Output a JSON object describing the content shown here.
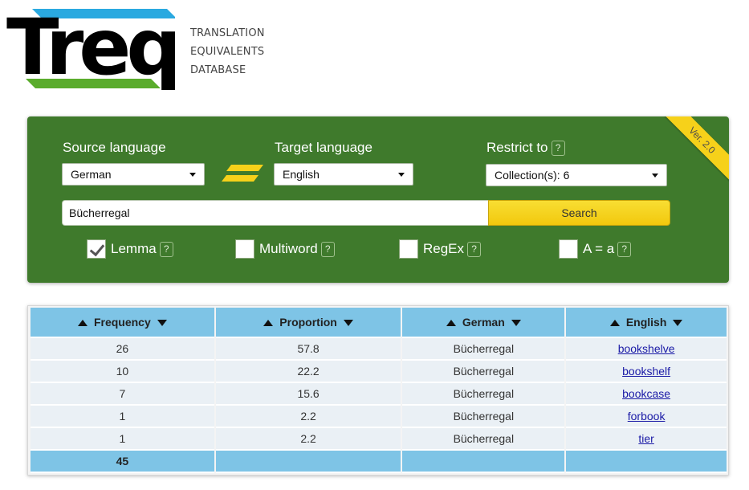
{
  "header": {
    "logo_word": "Treq",
    "subtitle_lines": [
      "TRANSLATION",
      "EQUIVALENTS",
      "DATABASE"
    ]
  },
  "panel": {
    "version_ribbon": "Ver. 2.0",
    "source_label": "Source language",
    "source_value": "German",
    "target_label": "Target language",
    "target_value": "English",
    "restrict_label": "Restrict to",
    "restrict_value": "Collection(s): 6",
    "help_glyph": "?",
    "search_value": "Bücherregal",
    "search_button": "Search",
    "options": [
      {
        "label": "Lemma",
        "checked": true
      },
      {
        "label": "Multiword",
        "checked": false
      },
      {
        "label": "RegEx",
        "checked": false
      },
      {
        "label": "A = a",
        "checked": false
      }
    ]
  },
  "table": {
    "headers": [
      "Frequency",
      "Proportion",
      "German",
      "English"
    ],
    "rows": [
      {
        "frequency": "26",
        "proportion": "57.8",
        "german": "Bücherregal",
        "english": "bookshelve"
      },
      {
        "frequency": "10",
        "proportion": "22.2",
        "german": "Bücherregal",
        "english": "bookshelf"
      },
      {
        "frequency": "7",
        "proportion": "15.6",
        "german": "Bücherregal",
        "english": "bookcase"
      },
      {
        "frequency": "1",
        "proportion": "2.2",
        "german": "Bücherregal",
        "english": "forbook"
      },
      {
        "frequency": "1",
        "proportion": "2.2",
        "german": "Bücherregal",
        "english": "tier"
      }
    ],
    "total_frequency": "45"
  },
  "colors": {
    "panel_green": "#3f7a2c",
    "accent_yellow": "#f6d11a",
    "table_header_blue": "#7ec4e6",
    "logo_blue": "#2aa9e0",
    "logo_green": "#5aac2c"
  }
}
